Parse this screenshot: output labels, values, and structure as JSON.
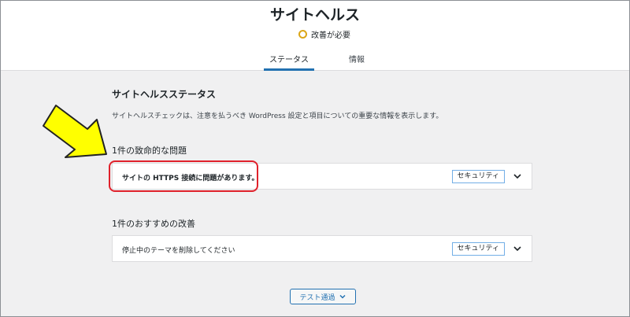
{
  "header": {
    "title": "サイトヘルス",
    "status": "改善が必要",
    "status_color": "#dba617",
    "tabs": [
      {
        "label": "ステータス",
        "active": true
      },
      {
        "label": "情報",
        "active": false
      }
    ]
  },
  "main": {
    "section_title": "サイトヘルスステータス",
    "description": "サイトヘルスチェックは、注意を払うべき WordPress 設定と項目についての重要な情報を表示します。",
    "critical": {
      "heading": "1件の致命的な問題",
      "items": [
        {
          "label": "サイトの HTTPS 接続に問題があります。",
          "badge": "セキュリティ"
        }
      ]
    },
    "recommended": {
      "heading": "1件のおすすめの改善",
      "items": [
        {
          "label": "停止中のテーマを削除してください",
          "badge": "セキュリティ"
        }
      ]
    },
    "passed_button": "テスト通過"
  },
  "annotations": {
    "arrow_color": "#ffff00",
    "highlight_color": "#e0212b"
  }
}
